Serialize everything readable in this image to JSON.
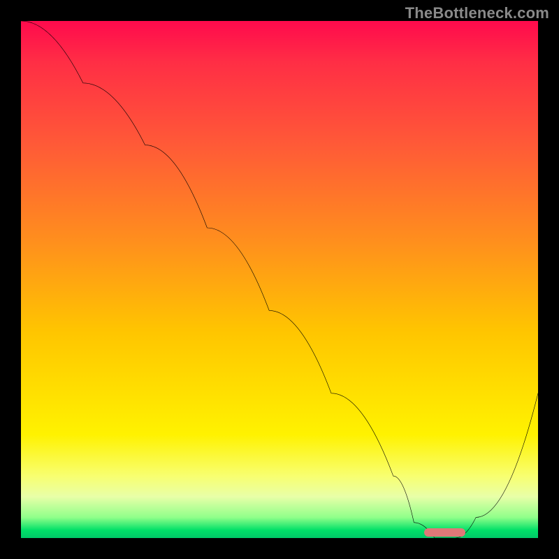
{
  "attribution": "TheBottleneck.com",
  "colors": {
    "frame": "#000000",
    "gradient_top": "#ff0a4d",
    "gradient_mid": "#ffd400",
    "gradient_bottom": "#00c868",
    "curve": "#000000",
    "marker": "#e07878",
    "attribution_text": "#8a8a8a"
  },
  "chart_data": {
    "type": "line",
    "title": "",
    "xlabel": "",
    "ylabel": "",
    "xlim": [
      0,
      100
    ],
    "ylim": [
      0,
      100
    ],
    "grid": false,
    "legend": false,
    "series": [
      {
        "name": "bottleneck-curve",
        "x": [
          0,
          12,
          24,
          36,
          48,
          60,
          72,
          76,
          80,
          84,
          88,
          100
        ],
        "y": [
          100,
          88,
          76,
          60,
          44,
          28,
          12,
          3,
          0,
          0,
          4,
          28
        ]
      }
    ],
    "marker": {
      "name": "optimal-range",
      "x_start": 78,
      "x_end": 86,
      "y": 0.5
    },
    "background_gradient_stops": [
      {
        "pos": 0.0,
        "color": "#ff0a4d"
      },
      {
        "pos": 0.24,
        "color": "#ff5a37"
      },
      {
        "pos": 0.6,
        "color": "#ffc500"
      },
      {
        "pos": 0.88,
        "color": "#f8ff70"
      },
      {
        "pos": 0.985,
        "color": "#00e068"
      },
      {
        "pos": 1.0,
        "color": "#00c868"
      }
    ]
  }
}
